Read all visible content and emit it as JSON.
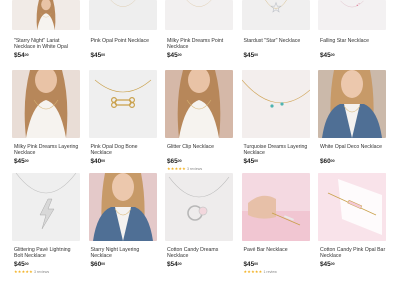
{
  "products": [
    {
      "name": "\"Starry Night\" Lariat Necklace in White Opal",
      "price": "$54",
      "cents": "00",
      "reviews": null,
      "bg": "#f1ebe7",
      "art": "model"
    },
    {
      "name": "Pink Opal Point Necklace",
      "price": "$45",
      "cents": "00",
      "reviews": null,
      "bg": "#eeeeee",
      "art": "plain"
    },
    {
      "name": "Milky Pink Dreams Point Necklace",
      "price": "$45",
      "cents": "00",
      "reviews": null,
      "bg": "#f2f0f0",
      "art": "plain"
    },
    {
      "name": "Stardust \"Star\" Necklace",
      "price": "$45",
      "cents": "00",
      "reviews": null,
      "bg": "#f0efef",
      "art": "star"
    },
    {
      "name": "Falling Star Necklace",
      "price": "$45",
      "cents": "00",
      "reviews": null,
      "bg": "#f3f1f2",
      "art": "falling"
    },
    {
      "name": "Milky Pink Dreams Layering Necklace",
      "price": "$45",
      "cents": "00",
      "reviews": null,
      "bg": "#e9ddd6",
      "art": "model"
    },
    {
      "name": "Pink Opal Dog Bone Necklace",
      "price": "$40",
      "cents": "00",
      "reviews": null,
      "bg": "#efefef",
      "art": "bone"
    },
    {
      "name": "Glitter Clip Necklace",
      "price": "$65",
      "cents": "00",
      "reviews": {
        "stars": "★★★★★",
        "count": "3 reviews"
      },
      "bg": "#d5b8a8",
      "art": "model"
    },
    {
      "name": "Turquoise Dreams Layering Necklace",
      "price": "$45",
      "cents": "00",
      "reviews": null,
      "bg": "#f4f0ef",
      "art": "turq"
    },
    {
      "name": "White Opal Deco Necklace",
      "price": "$60",
      "cents": "00",
      "reviews": null,
      "bg": "#cbb9aa",
      "art": "denim"
    },
    {
      "name": "Glittering Pavé Lightning Bolt Necklace",
      "price": "$45",
      "cents": "00",
      "reviews": {
        "stars": "★★★★★",
        "count": "3 reviews"
      },
      "bg": "#efefef",
      "art": "bolt"
    },
    {
      "name": "Starry Night Layering Necklace",
      "price": "$60",
      "cents": "00",
      "reviews": null,
      "bg": "#e4c9c9",
      "art": "denim"
    },
    {
      "name": "Cotton Candy Dreams Necklace",
      "price": "$54",
      "cents": "00",
      "reviews": null,
      "bg": "#eeecec",
      "art": "ring"
    },
    {
      "name": "Pavé Bar Necklace",
      "price": "$45",
      "cents": "00",
      "reviews": {
        "stars": "★★★★★",
        "count": "1 review"
      },
      "bg": "#f4d9e1",
      "art": "hand"
    },
    {
      "name": "Cotton Candy Pink Opal Bar Necklace",
      "price": "$45",
      "cents": "00",
      "reviews": null,
      "bg": "#f6dde4",
      "art": "bar"
    }
  ],
  "colors": {
    "star_yellow": "#f2b01e",
    "text": "#333333",
    "price": "#222222"
  }
}
